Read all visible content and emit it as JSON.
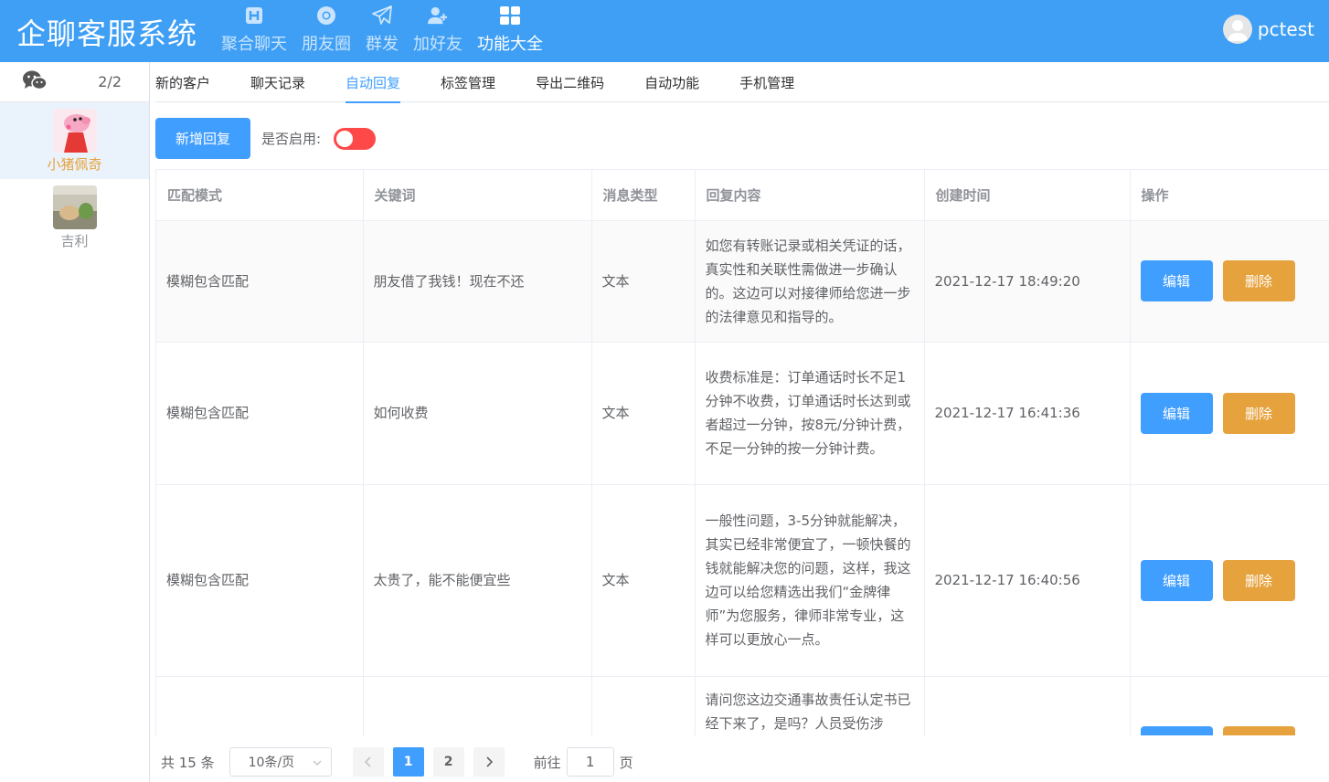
{
  "header": {
    "brand": "企聊客服系统",
    "nav": [
      {
        "label": "聚合聊天",
        "icon": "h-square-icon"
      },
      {
        "label": "朋友圈",
        "icon": "chrome-icon"
      },
      {
        "label": "群发",
        "icon": "paper-plane-icon"
      },
      {
        "label": "加好友",
        "icon": "user-plus-icon"
      },
      {
        "label": "功能大全",
        "icon": "grid-icon"
      }
    ],
    "active_nav": "功能大全",
    "username": "pctest"
  },
  "sidebar": {
    "account_count": "2/2",
    "contacts": [
      {
        "name": "小猪佩奇",
        "active": true
      },
      {
        "name": "吉利",
        "active": false
      }
    ]
  },
  "tabs": [
    "新的客户",
    "聊天记录",
    "自动回复",
    "标签管理",
    "导出二维码",
    "自动功能",
    "手机管理"
  ],
  "active_tab": "自动回复",
  "toolbar": {
    "add_label": "新增回复",
    "enable_label": "是否启用:",
    "enabled": false
  },
  "table": {
    "headers": [
      "匹配模式",
      "关键词",
      "消息类型",
      "回复内容",
      "创建时间",
      "操作"
    ],
    "edit_label": "编辑",
    "delete_label": "删除",
    "rows": [
      {
        "mode": "模糊包含匹配",
        "keyword": "朋友借了我钱！现在不还",
        "type": "文本",
        "content": "如您有转账记录或相关凭证的话，真实性和关联性需做进一步确认的。这边可以对接律师给您进一步的法律意见和指导的。",
        "created": "2021-12-17 18:49:20"
      },
      {
        "mode": "模糊包含匹配",
        "keyword": "如何收费",
        "type": "文本",
        "content": "收费标准是：订单通话时长不足1分钟不收费，订单通话时长达到或者超过一分钟，按8元/分钟计费，不足一分钟的按一分钟计费。",
        "created": "2021-12-17 16:41:36"
      },
      {
        "mode": "模糊包含匹配",
        "keyword": "太贵了，能不能便宜些",
        "type": "文本",
        "content": "一般性问题，3-5分钟就能解决，其实已经非常便宜了，一顿快餐的钱就能解决您的问题，这样，我这边可以给您精选出我们“金牌律师”为您服务，律师非常专业，这样可以更放心一点。",
        "created": "2021-12-17 16:40:56"
      },
      {
        "mode": "",
        "keyword": "",
        "type": "",
        "content": "请问您这边交通事故责任认定书已经下来了，是吗？人员受伤涉",
        "created": ""
      }
    ]
  },
  "pagination": {
    "total": "共 15 条",
    "page_size": "10条/页",
    "pages": [
      "1",
      "2"
    ],
    "current": "1",
    "goto_prefix": "前往",
    "goto_value": "1",
    "goto_suffix": "页"
  },
  "colors": {
    "header_bg": "#3f9ff5",
    "primary": "#409eff",
    "warning": "#e6a23c",
    "switch_off": "#ff4949"
  }
}
